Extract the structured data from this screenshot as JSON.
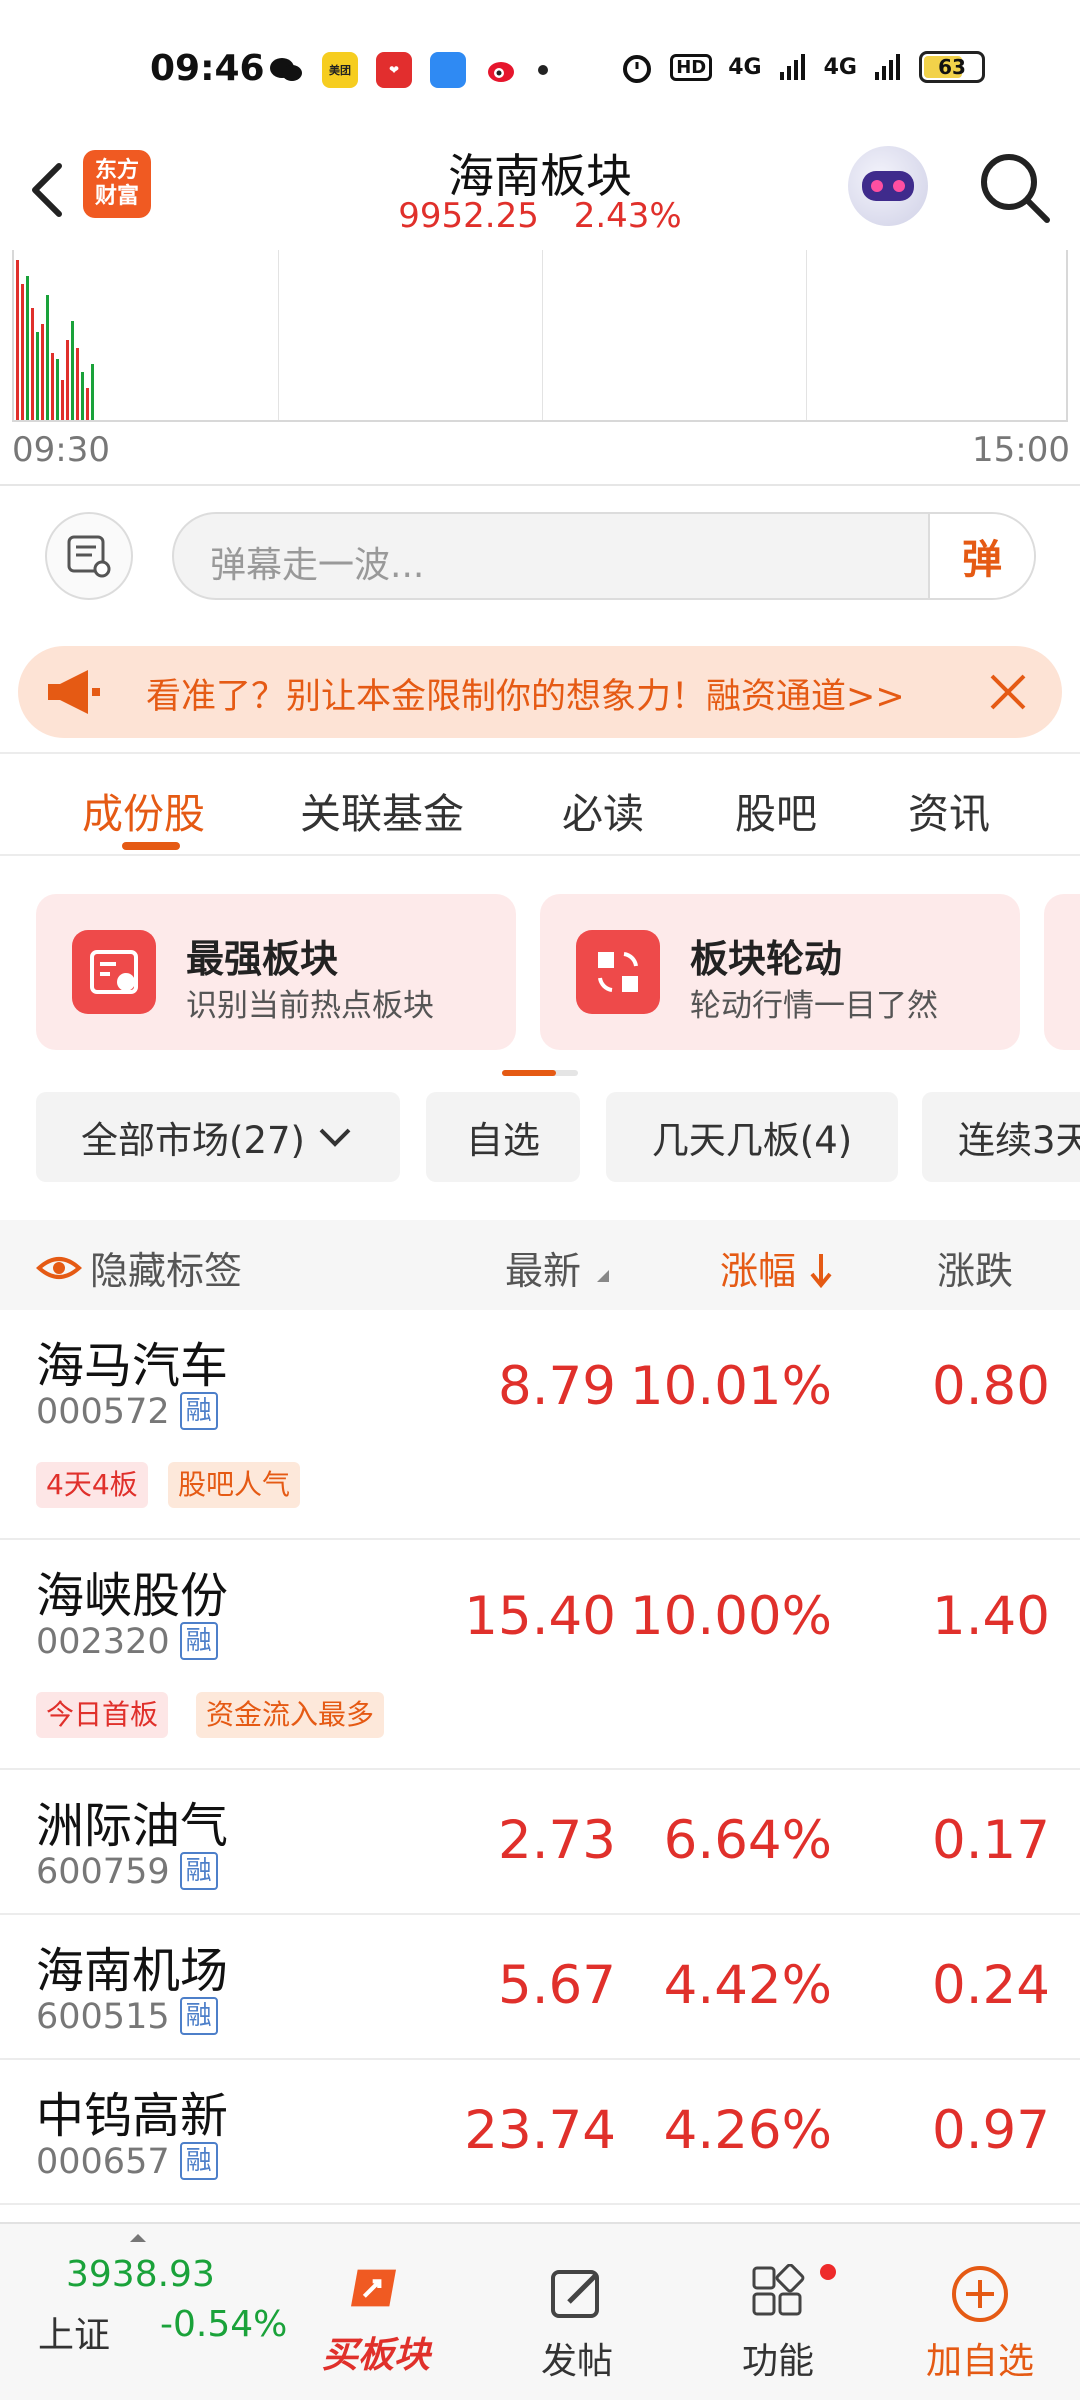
{
  "status_bar": {
    "time": "09:46",
    "battery": "63",
    "hd_label": "HD",
    "net_label": "4G"
  },
  "header": {
    "logo": "东方\n财富",
    "title": "海南板块",
    "index_value": "9952.25",
    "index_change": "2.43%"
  },
  "chart": {
    "start_time": "09:30",
    "end_time": "15:00"
  },
  "chart_data": {
    "type": "bar",
    "x": [
      "09:30",
      "09:31",
      "09:32",
      "09:33",
      "09:34",
      "09:35",
      "09:36",
      "09:37",
      "09:38",
      "09:39",
      "09:40",
      "09:41",
      "09:42",
      "09:43",
      "09:44",
      "09:45"
    ],
    "values": [
      100,
      85,
      90,
      70,
      55,
      60,
      78,
      42,
      38,
      25,
      50,
      62,
      45,
      30,
      20,
      35
    ],
    "colors": [
      "red",
      "red",
      "green",
      "red",
      "green",
      "red",
      "green",
      "red",
      "green",
      "red",
      "red",
      "green",
      "red",
      "green",
      "red",
      "green"
    ],
    "xlim": [
      "09:30",
      "15:00"
    ]
  },
  "danmaku": {
    "placeholder": "弹幕走一波...",
    "send_label": "弹"
  },
  "banner": {
    "text": "看准了？别让本金限制你的想象力！融资通道>>"
  },
  "tabs": [
    "成份股",
    "关联基金",
    "必读",
    "股吧",
    "资讯"
  ],
  "cards": [
    {
      "title": "最强板块",
      "desc": "识别当前热点板块"
    },
    {
      "title": "板块轮动",
      "desc": "轮动行情一目了然"
    }
  ],
  "filters": [
    "全部市场(27)",
    "自选",
    "几天几板(4)",
    "连续3天"
  ],
  "table": {
    "hide_tags": "隐藏标签",
    "col_latest": "最新",
    "col_pct": "涨幅",
    "col_change": "涨跌",
    "rong": "融"
  },
  "rows": [
    {
      "name": "海马汽车",
      "code": "000572",
      "price": "8.79",
      "pct": "10.01%",
      "change": "0.80",
      "tags": [
        "4天4板",
        "股吧人气"
      ]
    },
    {
      "name": "海峡股份",
      "code": "002320",
      "price": "15.40",
      "pct": "10.00%",
      "change": "1.40",
      "tags": [
        "今日首板",
        "资金流入最多"
      ]
    },
    {
      "name": "洲际油气",
      "code": "600759",
      "price": "2.73",
      "pct": "6.64%",
      "change": "0.17",
      "tags": []
    },
    {
      "name": "海南机场",
      "code": "600515",
      "price": "5.67",
      "pct": "4.42%",
      "change": "0.24",
      "tags": []
    },
    {
      "name": "中钨高新",
      "code": "000657",
      "price": "23.74",
      "pct": "4.26%",
      "change": "0.97",
      "tags": []
    }
  ],
  "bottom": {
    "index_value": "3938.93",
    "index_name": "上证",
    "index_change": "-0.54%",
    "buy_label": "买板块",
    "post_label": "发帖",
    "func_label": "功能",
    "add_label": "加自选"
  },
  "colors": {
    "accent": "#e55a14",
    "up": "#e0302b",
    "down": "#1aa23a"
  }
}
